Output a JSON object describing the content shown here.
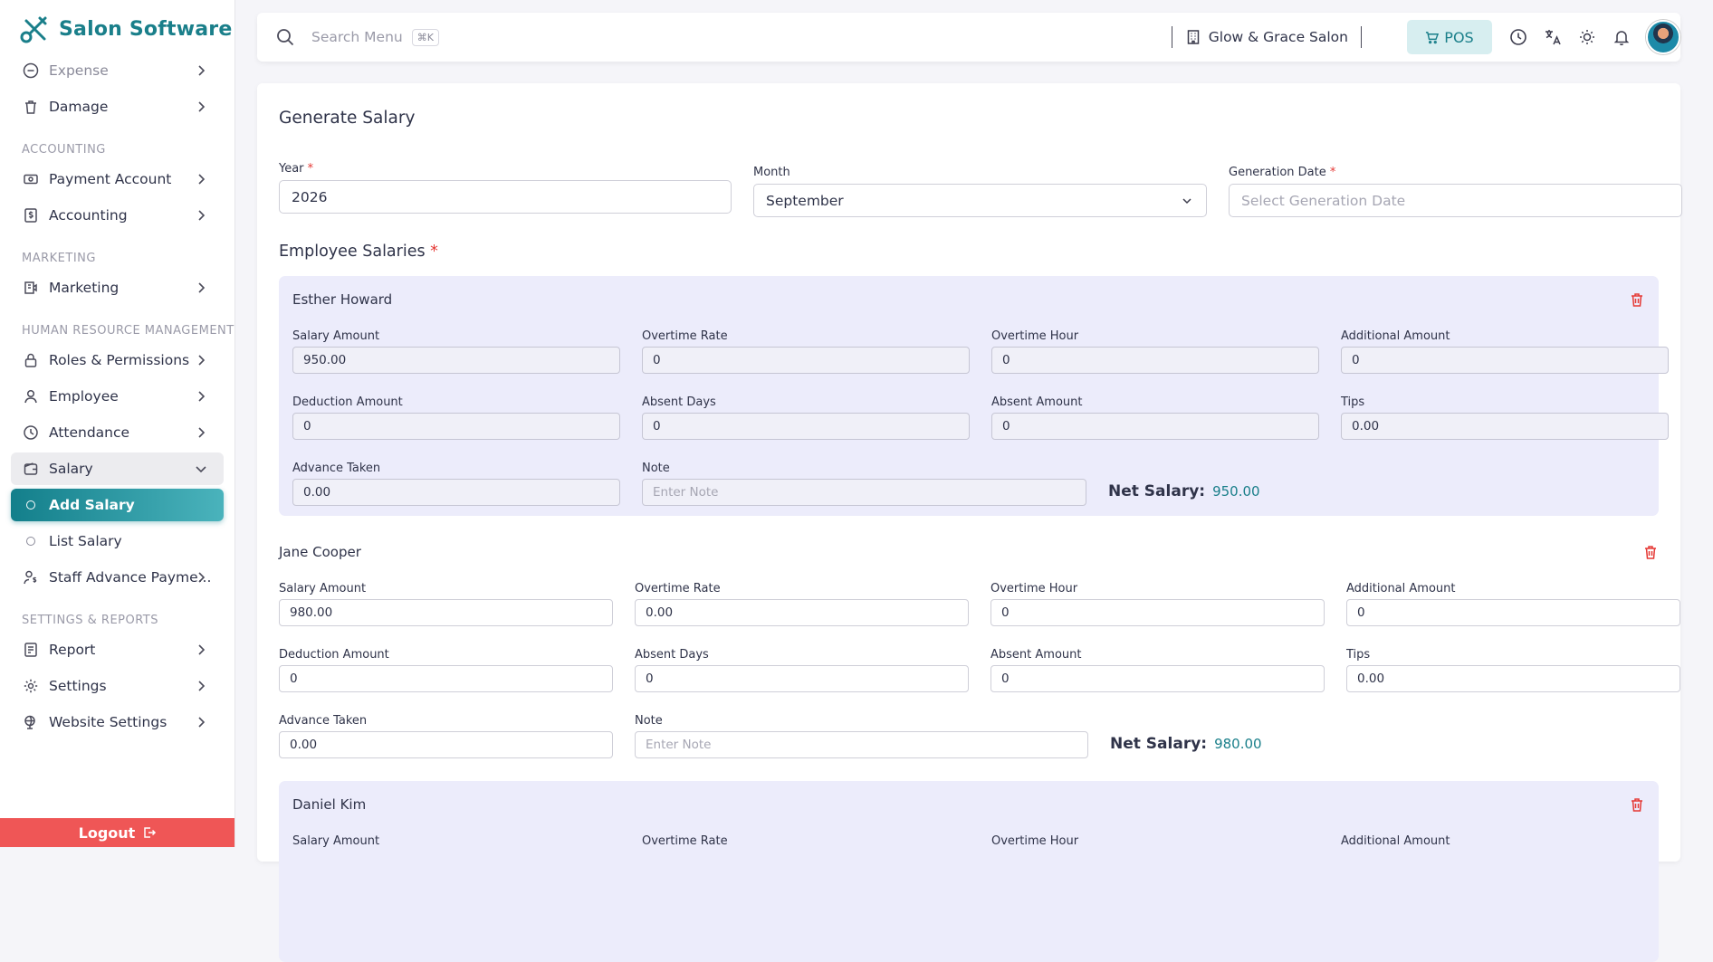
{
  "app": {
    "name": "Salon Software",
    "logout_label": "Logout"
  },
  "sidebar": {
    "top_items": [
      {
        "label": "Expense"
      },
      {
        "label": "Damage"
      }
    ],
    "sections": [
      {
        "title": "ACCOUNTING",
        "items": [
          {
            "label": "Payment Account"
          },
          {
            "label": "Accounting"
          }
        ]
      },
      {
        "title": "MARKETING",
        "items": [
          {
            "label": "Marketing"
          }
        ]
      },
      {
        "title": "HUMAN RESOURCE MANAGEMENT",
        "items": [
          {
            "label": "Roles & Permissions"
          },
          {
            "label": "Employee"
          },
          {
            "label": "Attendance"
          },
          {
            "label": "Salary"
          }
        ]
      },
      {
        "title": "SETTINGS & REPORTS",
        "items": [
          {
            "label": "Report"
          },
          {
            "label": "Settings"
          },
          {
            "label": "Website Settings"
          }
        ]
      }
    ],
    "salary_sub": [
      {
        "label": "Add Salary"
      },
      {
        "label": "List Salary"
      }
    ],
    "staff_advance": "Staff Advance Payme..."
  },
  "topbar": {
    "search_placeholder": "Search Menu",
    "shortcut": "⌘K",
    "branch": "Glow & Grace Salon",
    "pos_label": "POS"
  },
  "form": {
    "title": "Generate Salary",
    "year_label": "Year",
    "year_value": "2026",
    "month_label": "Month",
    "month_value": "September",
    "gen_date_label": "Generation Date",
    "gen_date_placeholder": "Select Generation Date",
    "employee_salaries_label": "Employee Salaries",
    "required_mark": "*",
    "labels": {
      "salary_amount": "Salary Amount",
      "overtime_rate": "Overtime Rate",
      "overtime_hour": "Overtime Hour",
      "additional_amount": "Additional Amount",
      "deduction_amount": "Deduction Amount",
      "absent_days": "Absent Days",
      "absent_amount": "Absent Amount",
      "tips": "Tips",
      "advance_taken": "Advance Taken",
      "note": "Note",
      "note_placeholder": "Enter Note",
      "net_salary": "Net Salary:"
    }
  },
  "employees": [
    {
      "name": "Esther Howard",
      "salary_amount": "950.00",
      "overtime_rate": "0",
      "overtime_hour": "0",
      "additional_amount": "0",
      "deduction_amount": "0",
      "absent_days": "0",
      "absent_amount": "0",
      "tips": "0.00",
      "advance_taken": "0.00",
      "net_salary": "950.00"
    },
    {
      "name": "Jane Cooper",
      "salary_amount": "980.00",
      "overtime_rate": "0.00",
      "overtime_hour": "0",
      "additional_amount": "0",
      "deduction_amount": "0",
      "absent_days": "0",
      "absent_amount": "0",
      "tips": "0.00",
      "advance_taken": "0.00",
      "net_salary": "980.00"
    },
    {
      "name": "Daniel Kim"
    }
  ],
  "colors": {
    "brand": "#1a7f8a",
    "active_start": "#137f8b",
    "active_end": "#4ab3bc",
    "danger": "#ef5656",
    "shaded_row": "#ececfb"
  }
}
